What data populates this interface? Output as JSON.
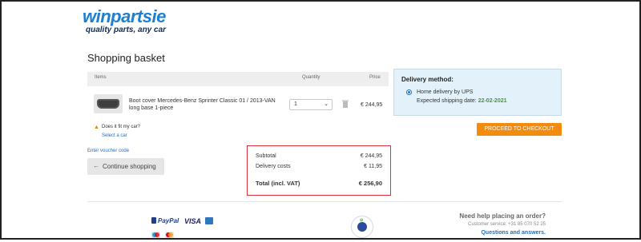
{
  "logo": {
    "name": "winpartsie",
    "tagline": "quality parts, any car"
  },
  "page_title": "Shopping basket",
  "basket": {
    "columns": {
      "items": "Items",
      "quantity": "Quantity",
      "price": "Price"
    },
    "item": {
      "name": "Boot cover Mercedes-Benz Sprinter Classic 01 / 2013-VAN long base 1-piece",
      "quantity": "1",
      "price": "€ 244,95",
      "fit_question": "Does it fit my car?",
      "select_car": "Select a car"
    }
  },
  "voucher_link": "Enter voucher code",
  "continue_button": "Continue shopping",
  "totals": {
    "subtotal_label": "Subtotal",
    "subtotal_value": "€ 244,95",
    "delivery_label": "Delivery costs",
    "delivery_value": "€ 11,95",
    "total_label": "Total (incl. VAT)",
    "total_value": "€ 256,90"
  },
  "delivery": {
    "title": "Delivery method:",
    "option": "Home delivery by UPS",
    "shipping_label": "Expected shipping date:",
    "shipping_date": "22-02-2021"
  },
  "checkout_button": "PROCEED TO CHECKOUT",
  "footer": {
    "paypal": "PayPal",
    "visa": "VISA",
    "help_title": "Need help placing an order?",
    "help_service": "Customer service: +31 85 070 52 25",
    "help_link": "Questions and answers."
  },
  "colors": {
    "accent": "#f28b0e",
    "link": "#1d6fc4",
    "logo_blue": "#1d7fd1",
    "total_border": "#e0303a",
    "delivery_bg": "#e3f2fa",
    "date_green": "#3b9c2e"
  },
  "icons": [
    "trash-icon",
    "warning-icon",
    "arrow-left-icon",
    "chevron-down-icon"
  ]
}
